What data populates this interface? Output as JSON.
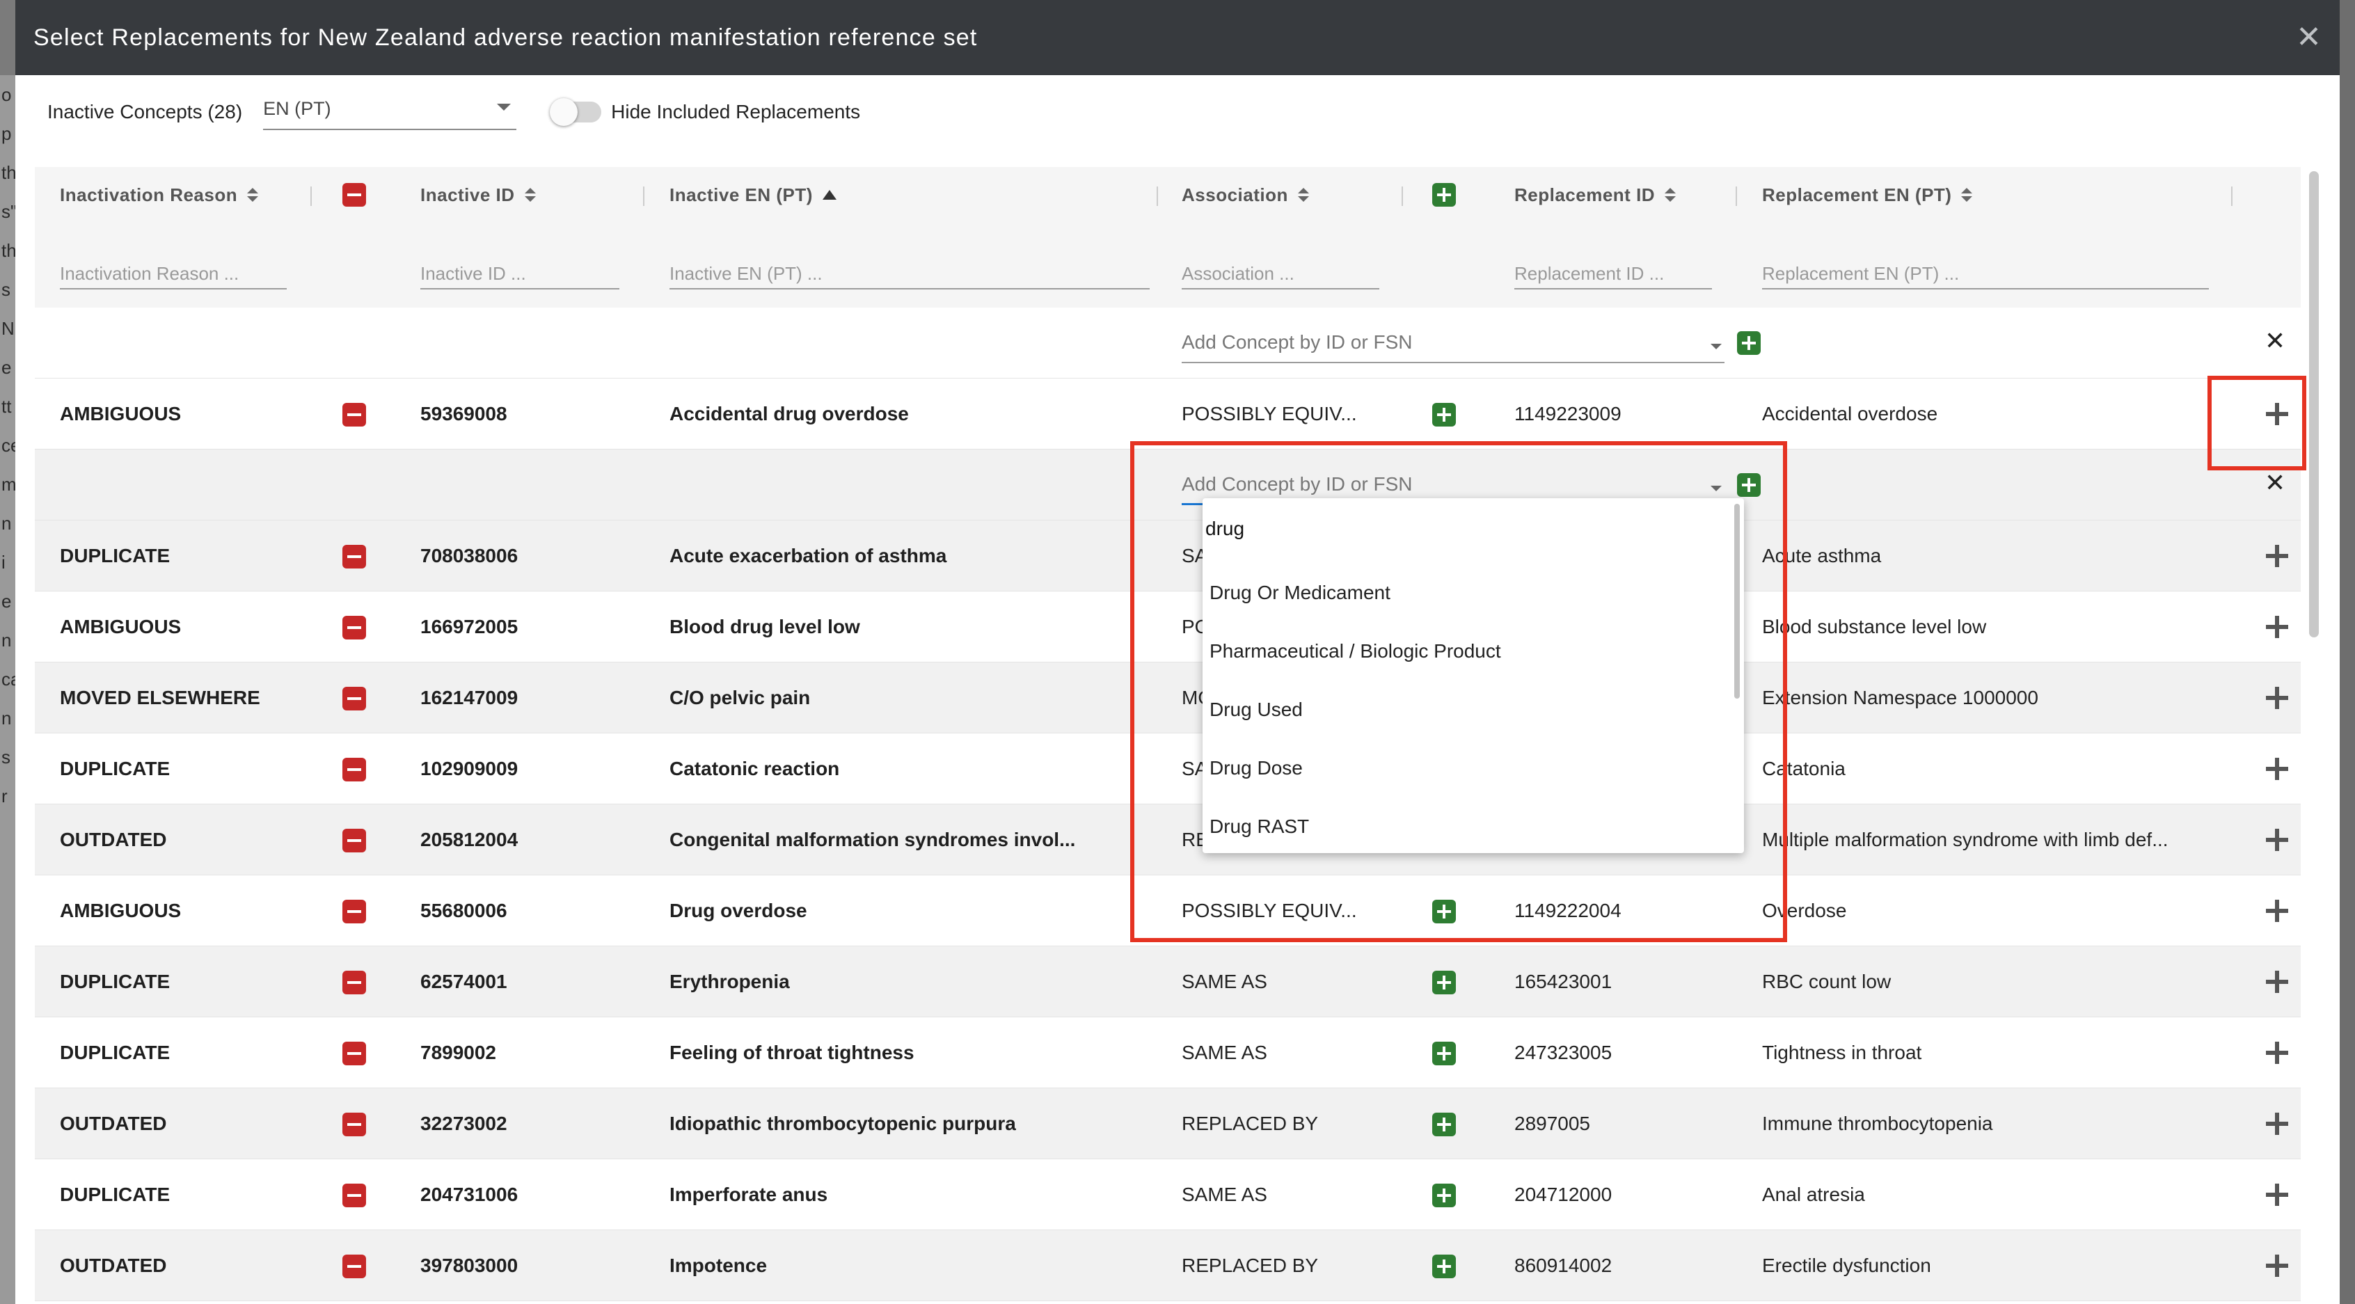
{
  "modal": {
    "title": "Select Replacements for New Zealand adverse reaction manifestation reference set"
  },
  "toolbar": {
    "inactive_concepts_label": "Inactive Concepts (28)",
    "language_value": "EN (PT)",
    "hide_toggle_label": "Hide Included Replacements"
  },
  "columns": {
    "inactivation_reason": "Inactivation Reason",
    "inactive_id": "Inactive ID",
    "inactive_en": "Inactive EN (PT)",
    "association": "Association",
    "replacement_id": "Replacement ID",
    "replacement_en": "Replacement EN (PT)"
  },
  "filters": {
    "inactivation_reason": "Inactivation Reason ...",
    "inactive_id": "Inactive ID ...",
    "inactive_en": "Inactive EN (PT) ...",
    "association": "Association ...",
    "replacement_id": "Replacement ID ...",
    "replacement_en": "Replacement EN (PT) ..."
  },
  "add_concept_placeholder": "Add Concept by ID or FSN",
  "autocomplete": {
    "query": "drug",
    "options": [
      "Drug Or Medicament",
      "Pharmaceutical / Biologic Product",
      "Drug Used",
      "Drug Dose",
      "Drug RAST"
    ]
  },
  "rows": [
    {
      "reason": "AMBIGUOUS",
      "inactive_id": "59369008",
      "inactive_en": "Accidental drug overdose",
      "association": "POSSIBLY EQUIV...",
      "replacement_id": "1149223009",
      "replacement_en": "Accidental overdose"
    },
    {
      "reason": "DUPLICATE",
      "inactive_id": "708038006",
      "inactive_en": "Acute exacerbation of asthma",
      "association": "SAME AS",
      "replacement_id": "",
      "replacement_en": "Acute asthma"
    },
    {
      "reason": "AMBIGUOUS",
      "inactive_id": "166972005",
      "inactive_en": "Blood drug level low",
      "association": "POSSIBLY EQUIV...",
      "replacement_id": "",
      "replacement_en": "Blood substance level low"
    },
    {
      "reason": "MOVED ELSEWHERE",
      "inactive_id": "162147009",
      "inactive_en": "C/O pelvic pain",
      "association": "MOVED TO",
      "replacement_id": "",
      "replacement_en": "Extension Namespace 1000000"
    },
    {
      "reason": "DUPLICATE",
      "inactive_id": "102909009",
      "inactive_en": "Catatonic reaction",
      "association": "SAME AS",
      "replacement_id": "",
      "replacement_en": "Catatonia"
    },
    {
      "reason": "OUTDATED",
      "inactive_id": "205812004",
      "inactive_en": "Congenital malformation syndromes invol...",
      "association": "REPLACED BY",
      "replacement_id": "",
      "replacement_en": "Multiple malformation syndrome with limb def..."
    },
    {
      "reason": "AMBIGUOUS",
      "inactive_id": "55680006",
      "inactive_en": "Drug overdose",
      "association": "POSSIBLY EQUIV...",
      "replacement_id": "1149222004",
      "replacement_en": "Overdose"
    },
    {
      "reason": "DUPLICATE",
      "inactive_id": "62574001",
      "inactive_en": "Erythropenia",
      "association": "SAME AS",
      "replacement_id": "165423001",
      "replacement_en": "RBC count low"
    },
    {
      "reason": "DUPLICATE",
      "inactive_id": "7899002",
      "inactive_en": "Feeling of throat tightness",
      "association": "SAME AS",
      "replacement_id": "247323005",
      "replacement_en": "Tightness in throat"
    },
    {
      "reason": "OUTDATED",
      "inactive_id": "32273002",
      "inactive_en": "Idiopathic thrombocytopenic purpura",
      "association": "REPLACED BY",
      "replacement_id": "2897005",
      "replacement_en": "Immune thrombocytopenia"
    },
    {
      "reason": "DUPLICATE",
      "inactive_id": "204731006",
      "inactive_en": "Imperforate anus",
      "association": "SAME AS",
      "replacement_id": "204712000",
      "replacement_en": "Anal atresia"
    },
    {
      "reason": "OUTDATED",
      "inactive_id": "397803000",
      "inactive_en": "Impotence",
      "association": "REPLACED BY",
      "replacement_id": "860914002",
      "replacement_en": "Erectile dysfunction"
    }
  ],
  "colors": {
    "accent_red": "#e53322",
    "remove_red": "#c62828",
    "add_green": "#2e7d32",
    "titlebar": "#373a3e",
    "focus_blue": "#1976d2"
  }
}
